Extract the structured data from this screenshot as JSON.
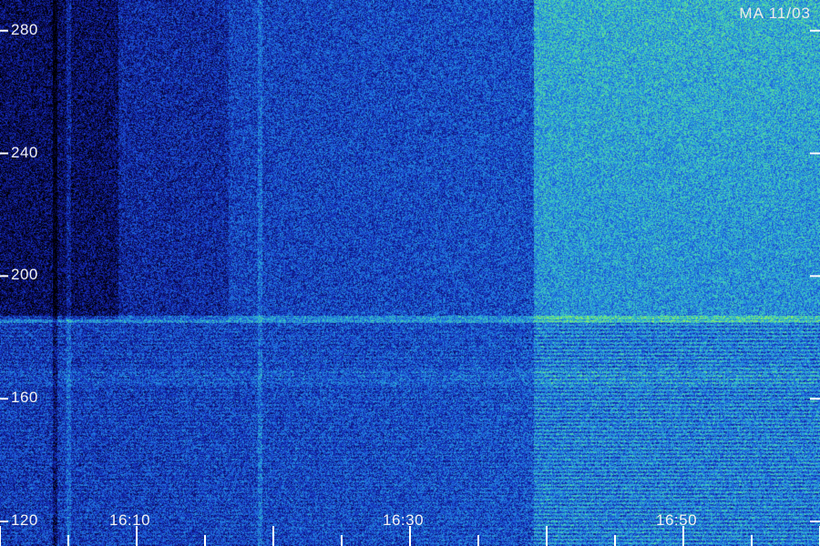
{
  "title": "MA 11/03",
  "chart_data": {
    "type": "heatmap",
    "title": "MA 11/03",
    "xlabel": "",
    "ylabel": "",
    "x_ticks": [
      "16:10",
      "16:30",
      "16:50"
    ],
    "y_ticks": [
      280,
      240,
      200,
      160,
      120
    ],
    "x_range": [
      "16:00",
      "17:00"
    ],
    "y_range": [
      112,
      290
    ],
    "grid": false,
    "legend": "none",
    "colormap": [
      "#000000",
      "#0a0a5a",
      "#1428b4",
      "#1e64dc",
      "#28a0dc",
      "#46d2b4",
      "#8cf064"
    ],
    "features": {
      "bright_region_start_time": "16:39",
      "band_edge_value": 186,
      "interference_band_value": 167,
      "vertical_lines_time": [
        "16:04",
        "16:05",
        "16:19"
      ]
    }
  }
}
